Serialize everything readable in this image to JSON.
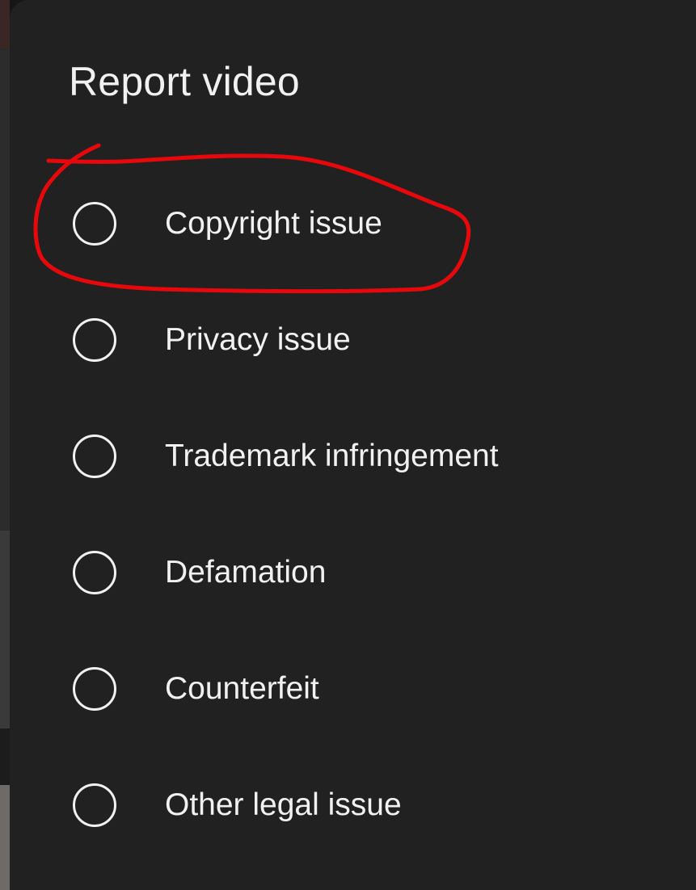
{
  "dialog": {
    "title": "Report video",
    "options": [
      {
        "label": "Copyright issue",
        "selected": false
      },
      {
        "label": "Privacy issue",
        "selected": false
      },
      {
        "label": "Trademark infringement",
        "selected": false
      },
      {
        "label": "Defamation",
        "selected": false
      },
      {
        "label": "Counterfeit",
        "selected": false
      },
      {
        "label": "Other legal issue",
        "selected": false
      }
    ]
  },
  "annotation": {
    "color": "#e8080c",
    "shape": "hand-drawn-loop",
    "highlights": "Copyright issue"
  },
  "colors": {
    "sheet_background": "#212121",
    "text": "#f1f1f1"
  }
}
